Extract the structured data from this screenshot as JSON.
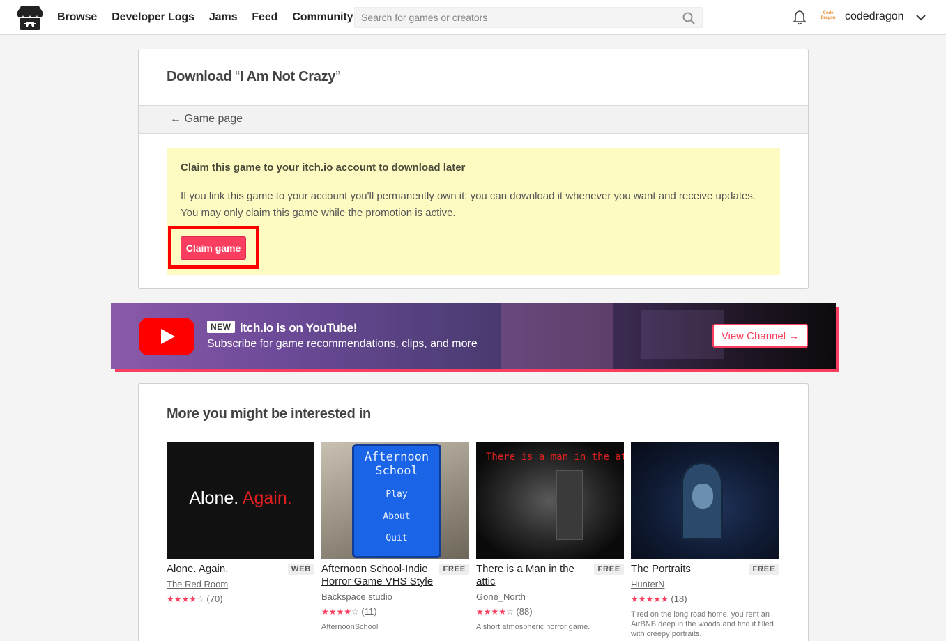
{
  "header": {
    "nav": [
      "Browse",
      "Developer Logs",
      "Jams",
      "Feed",
      "Community"
    ],
    "search_placeholder": "Search for games or creators",
    "avatar_text": "Code Dragon",
    "username": "codedragon"
  },
  "download": {
    "title_prefix": "Download",
    "open_quote": "“",
    "game_name": "I Am Not Crazy",
    "close_quote": "”",
    "back_link": "← Game page",
    "claim_title": "Claim this game to your itch.io account to download later",
    "claim_text": "If you link this game to your account you'll permanently own it: you can download it whenever you want and receive updates. You may only claim this game while the promotion is active.",
    "claim_button": "Claim game"
  },
  "youtube": {
    "badge": "NEW",
    "title": "itch.io is on YouTube!",
    "subtitle": "Subscribe for game recommendations, clips, and more",
    "button": "View Channel →"
  },
  "recommendations": {
    "title": "More you might be interested in",
    "games": [
      {
        "title": "Alone. Again.",
        "tag": "WEB",
        "author": "The Red Room",
        "stars": 4.5,
        "star_glyphs": "★★★★",
        "star_off": "☆",
        "count": "(70)",
        "thumb_text_1": "Alone.",
        "thumb_text_2": "Again."
      },
      {
        "title": "Afternoon School-Indie Horror Game VHS Style",
        "tag": "FREE",
        "author": "Backspace studio",
        "stars": 4,
        "star_glyphs": "★★★★",
        "star_off": "☆",
        "count": "(11)",
        "desc": "AfternoonSchool",
        "thumb_title": "Afternoon School",
        "thumb_menu": [
          "Play",
          "About",
          "Quit"
        ]
      },
      {
        "title": "There is a Man in the attic",
        "tag": "FREE",
        "author": "Gone_North",
        "stars": 4,
        "star_glyphs": "★★★★",
        "star_off": "☆",
        "count": "(88)",
        "desc": "A short atmospheric horror game.",
        "thumb_caption": "There is a man in the attic"
      },
      {
        "title": "The Portraits",
        "tag": "FREE",
        "author": "HunterN",
        "stars": 5,
        "star_glyphs": "★★★★★",
        "star_off": "",
        "count": "(18)",
        "desc": "Tired on the long road home, you rent an AirBNB deep in the woods and find it filled with creepy portraits."
      }
    ]
  },
  "colors": {
    "accent": "#fa3e5f",
    "highlight_box": "#ff0000",
    "claim_bg": "#fdfbc2",
    "youtube_red": "#ff0000"
  }
}
